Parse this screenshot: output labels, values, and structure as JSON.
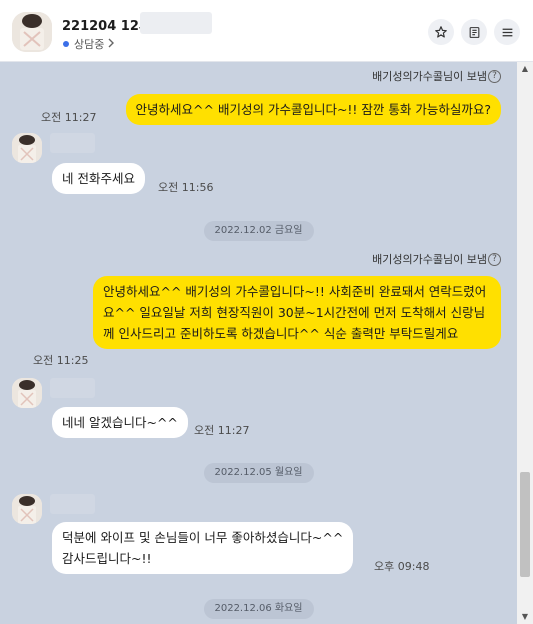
{
  "header": {
    "title": "221204 12시",
    "status": "상담중",
    "icons": [
      "star-icon",
      "document-icon",
      "menu-icon"
    ]
  },
  "messages": {
    "sender_label": "배기성의가수콜님이 보냄",
    "help_glyph": "?",
    "m1": {
      "text": "안녕하세요^^ 배기성의 가수콜입니다~!! 잠깐 통화 가능하실까요?",
      "time": "오전 11:27"
    },
    "r1": {
      "text": "네 전화주세요",
      "time": "오전 11:56"
    },
    "date1": "2022.12.02 금요일",
    "m2": {
      "text": "안녕하세요^^ 배기성의 가수콜입니다~!! 사회준비 완료돼서 연락드렸어요^^ 일요일날 저희 현장직원이 30분~1시간전에 먼저 도착해서 신랑님께 인사드리고 준비하도록 하겠습니다^^ 식순 출력만 부탁드릴게요",
      "time": "오전 11:25"
    },
    "r2": {
      "text": "네네 알겠습니다~^^",
      "time": "오전 11:27"
    },
    "date2": "2022.12.05 월요일",
    "r3": {
      "line1": "덕분에 와이프 및 손님들이 너무 좋아하셨습니다~^^",
      "line2": "감사드립니다~!!",
      "time": "오후 09:48"
    },
    "date3": "2022.12.06 화요일"
  },
  "scrollbar": {
    "up": "▲",
    "down": "▼"
  },
  "colors": {
    "background": "#c9d2e0",
    "my_bubble": "#ffe000",
    "their_bubble": "#ffffff",
    "status_dot": "#3b6fe8"
  }
}
